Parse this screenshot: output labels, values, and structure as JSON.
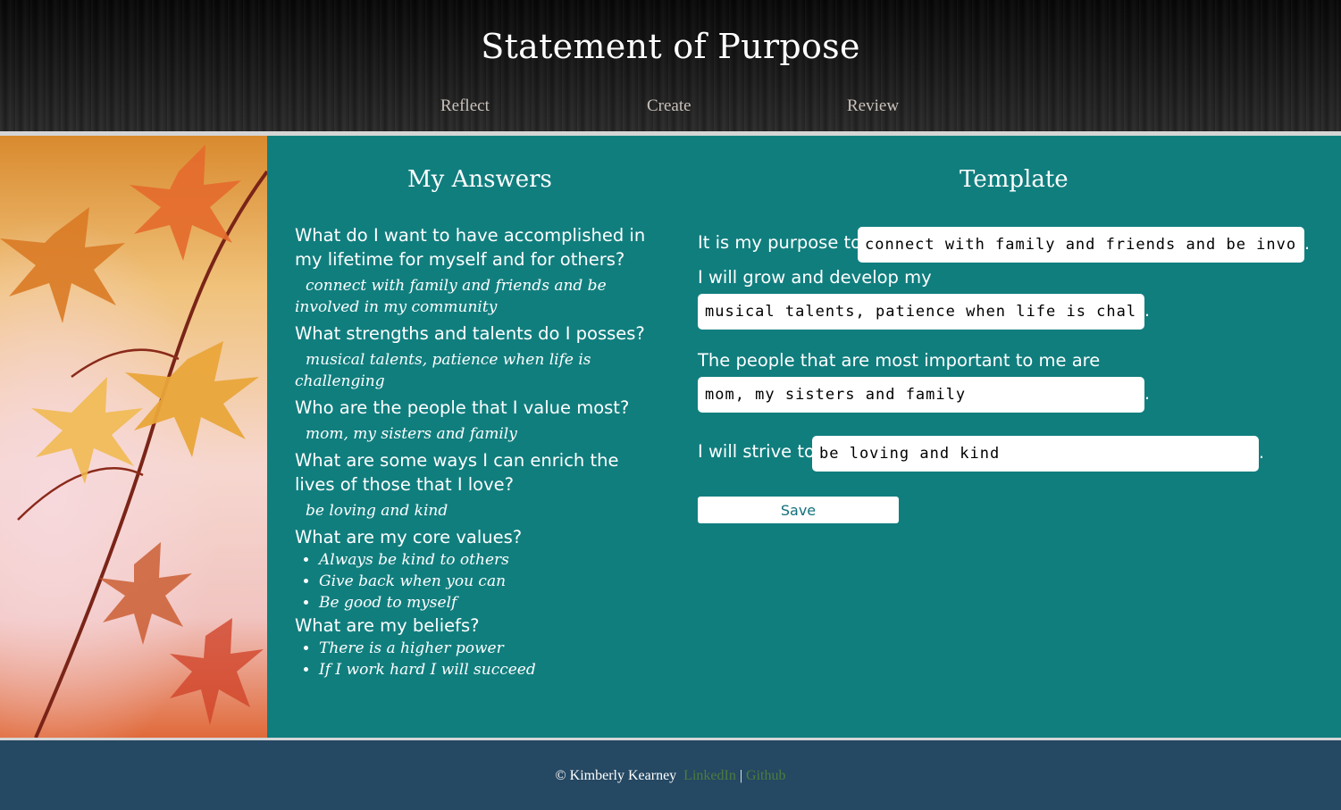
{
  "header": {
    "title": "Statement of Purpose",
    "nav": [
      "Reflect",
      "Create",
      "Review"
    ]
  },
  "answers": {
    "heading": "My Answers",
    "q1": "What do I want to have accomplished in my lifetime for myself and for others?",
    "a1": "connect with family and friends and be involved in my community",
    "q2": "What strengths and talents do I posses?",
    "a2": "musical talents, patience when life is challenging",
    "q3": "Who are the people that I value most?",
    "a3": "mom, my sisters and family",
    "q4": "What are some ways I can enrich the lives of those that I love?",
    "a4": "be loving and kind",
    "q5": "What are my core values?",
    "values": [
      "Always be kind to others",
      "Give back when you can",
      "Be good to myself"
    ],
    "q6": "What are my beliefs?",
    "beliefs": [
      "There is a higher power",
      "If I work hard I will succeed"
    ]
  },
  "template": {
    "heading": "Template",
    "purpose_label": "It is my purpose to",
    "purpose_value": "connect with family and friends and be involved in my community",
    "grow_label": "I will grow and develop my",
    "grow_value": "musical talents, patience when life is challenging",
    "people_label": "The people that are most important to me are",
    "people_value": "mom, my sisters and family",
    "strive_label": "I will strive to",
    "strive_value": "be loving and kind",
    "period": ".",
    "save_label": "Save"
  },
  "footer": {
    "copyright": "© Kimberly Kearney",
    "linkedin": "LinkedIn",
    "separator": "|",
    "github": "Github"
  },
  "colors": {
    "main_bg": "#117e7e",
    "footer_bg": "#254863",
    "link": "#4d7d3d"
  }
}
